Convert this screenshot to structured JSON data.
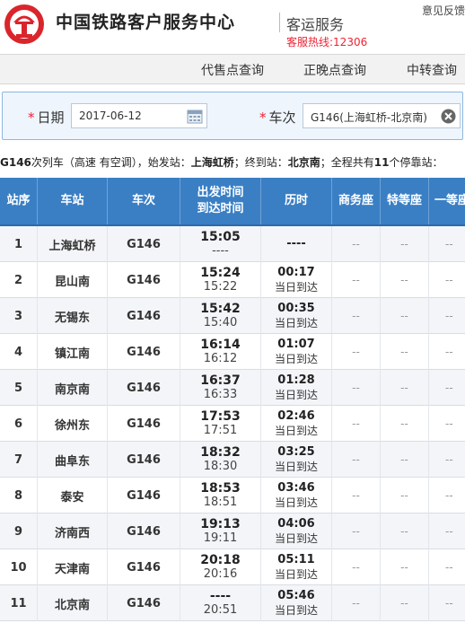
{
  "header": {
    "title": "中国铁路客户服务中心",
    "service": "客运服务",
    "hotline": "客服热线:12306",
    "feedback": "意见反馈"
  },
  "nav": [
    {
      "label": "代售点查询"
    },
    {
      "label": "正晚点查询"
    },
    {
      "label": "中转查询"
    }
  ],
  "query": {
    "date_label": "日期",
    "date_value": "2017-06-12",
    "train_label": "车次",
    "train_value": "G146(上海虹桥-北京南)"
  },
  "summary": {
    "train": "G146",
    "prefix": "次列车（高速 有空调），始发站：",
    "start": "上海虹桥",
    "mid1": "；终到站：",
    "end": "北京南",
    "mid2": "；全程共有",
    "count": "11",
    "suffix": "个停靠站："
  },
  "table": {
    "headers": {
      "no": "站序",
      "station": "车站",
      "train": "车次",
      "time_dep": "出发时间",
      "time_arr": "到达时间",
      "duration": "历时",
      "business": "商务座",
      "premium": "特等座",
      "first": "一等座"
    },
    "rows": [
      {
        "no": "1",
        "station": "上海虹桥",
        "train": "G146",
        "dep": "15:05",
        "arr": "----",
        "dur": "----",
        "note": "",
        "s1": "--",
        "s2": "--",
        "s3": "--"
      },
      {
        "no": "2",
        "station": "昆山南",
        "train": "G146",
        "dep": "15:24",
        "arr": "15:22",
        "dur": "00:17",
        "note": "当日到达",
        "s1": "--",
        "s2": "--",
        "s3": "--"
      },
      {
        "no": "3",
        "station": "无锡东",
        "train": "G146",
        "dep": "15:42",
        "arr": "15:40",
        "dur": "00:35",
        "note": "当日到达",
        "s1": "--",
        "s2": "--",
        "s3": "--"
      },
      {
        "no": "4",
        "station": "镇江南",
        "train": "G146",
        "dep": "16:14",
        "arr": "16:12",
        "dur": "01:07",
        "note": "当日到达",
        "s1": "--",
        "s2": "--",
        "s3": "--"
      },
      {
        "no": "5",
        "station": "南京南",
        "train": "G146",
        "dep": "16:37",
        "arr": "16:33",
        "dur": "01:28",
        "note": "当日到达",
        "s1": "--",
        "s2": "--",
        "s3": "--"
      },
      {
        "no": "6",
        "station": "徐州东",
        "train": "G146",
        "dep": "17:53",
        "arr": "17:51",
        "dur": "02:46",
        "note": "当日到达",
        "s1": "--",
        "s2": "--",
        "s3": "--"
      },
      {
        "no": "7",
        "station": "曲阜东",
        "train": "G146",
        "dep": "18:32",
        "arr": "18:30",
        "dur": "03:25",
        "note": "当日到达",
        "s1": "--",
        "s2": "--",
        "s3": "--"
      },
      {
        "no": "8",
        "station": "泰安",
        "train": "G146",
        "dep": "18:53",
        "arr": "18:51",
        "dur": "03:46",
        "note": "当日到达",
        "s1": "--",
        "s2": "--",
        "s3": "--"
      },
      {
        "no": "9",
        "station": "济南西",
        "train": "G146",
        "dep": "19:13",
        "arr": "19:11",
        "dur": "04:06",
        "note": "当日到达",
        "s1": "--",
        "s2": "--",
        "s3": "--"
      },
      {
        "no": "10",
        "station": "天津南",
        "train": "G146",
        "dep": "20:18",
        "arr": "20:16",
        "dur": "05:11",
        "note": "当日到达",
        "s1": "--",
        "s2": "--",
        "s3": "--"
      },
      {
        "no": "11",
        "station": "北京南",
        "train": "G146",
        "dep": "----",
        "arr": "20:51",
        "dur": "05:46",
        "note": "当日到达",
        "s1": "--",
        "s2": "--",
        "s3": "--"
      }
    ]
  },
  "colors": {
    "header_blue": "#3a7fc4",
    "accent_red": "#e23"
  }
}
